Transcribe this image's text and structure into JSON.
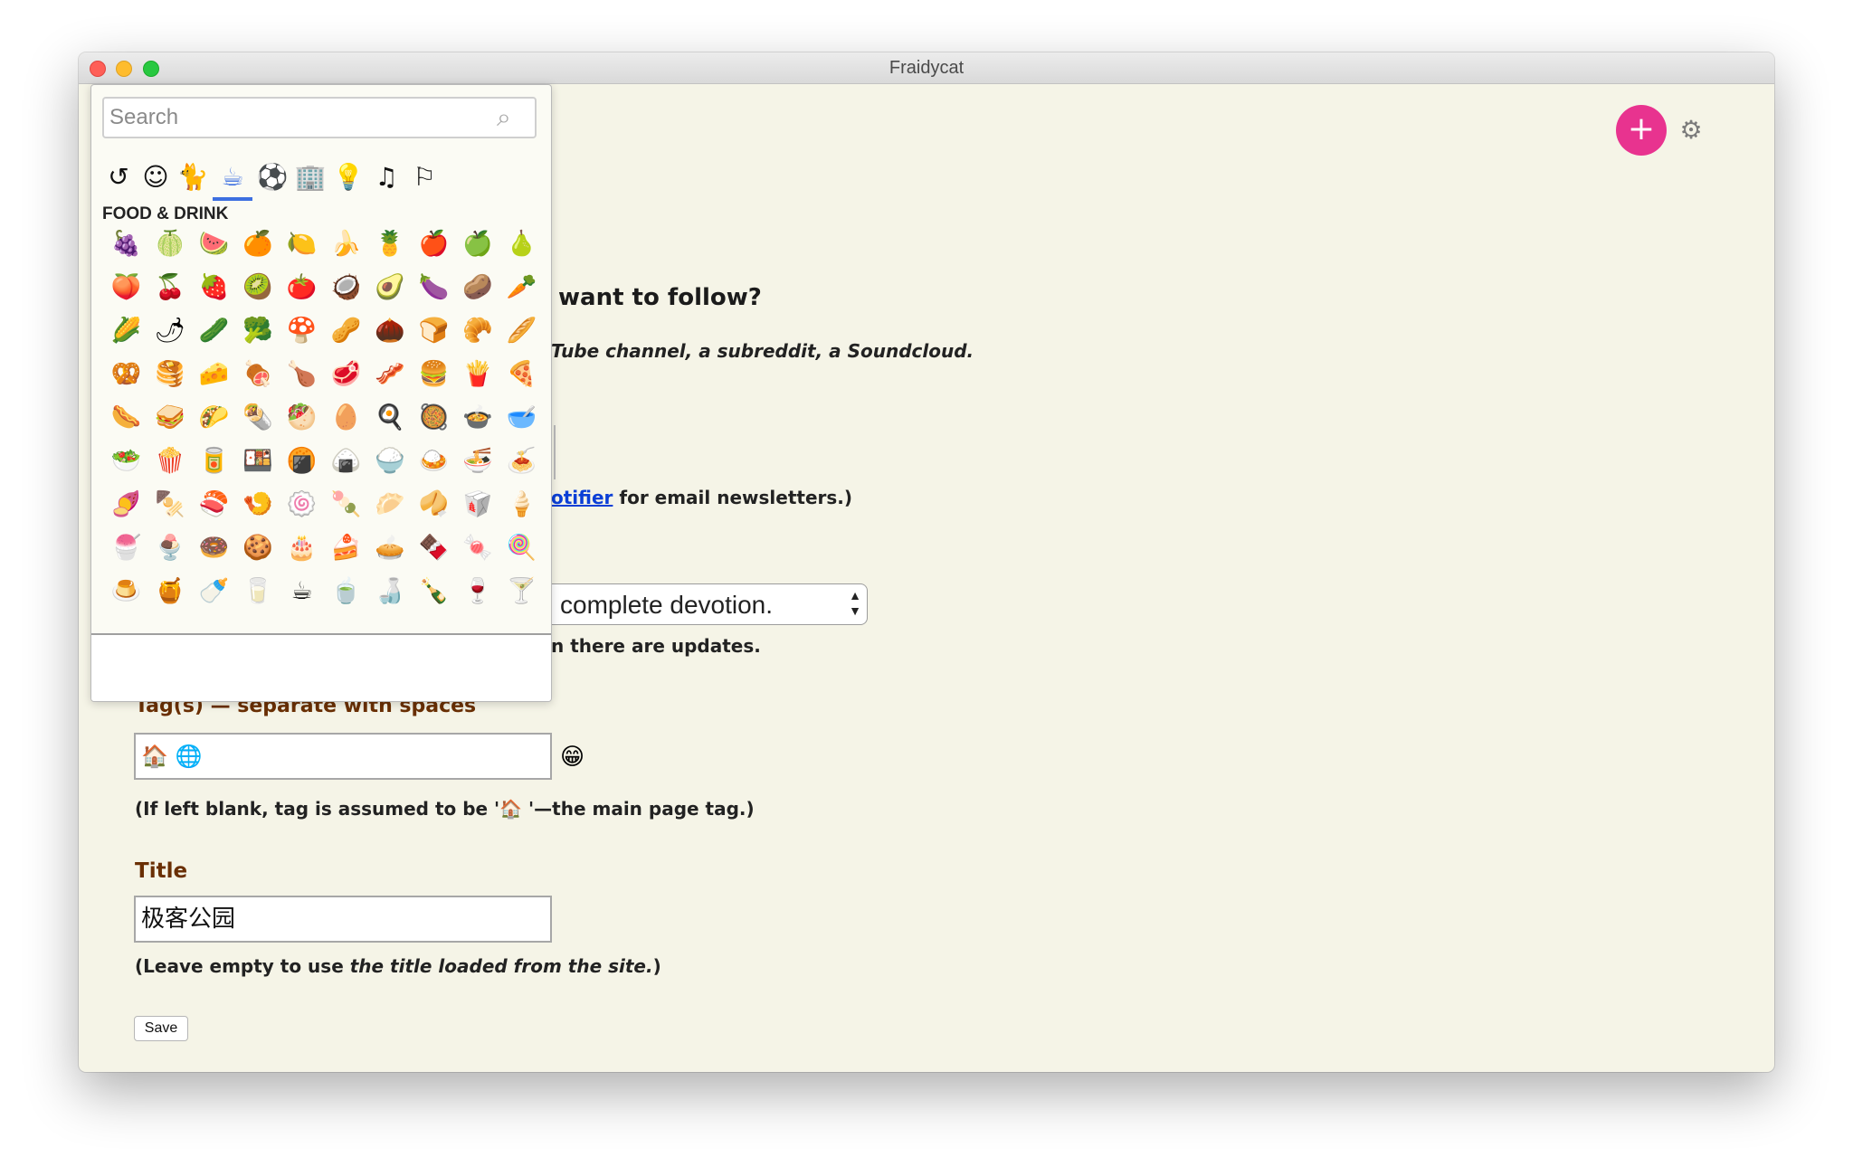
{
  "window": {
    "title": "Fraidycat"
  },
  "page": {
    "heading_partial": "want to follow?",
    "subheading_partial": "Tube channel, a subreddit, a Soundcloud.",
    "notifier_link_partial": "otifier",
    "notifier_suffix": " for email newsletters.)",
    "frequency_select_partial": "complete devotion.",
    "updates_help_partial": "n there are updates.",
    "tags_label": "Tag(s) — separate with spaces",
    "tags_value": "🏠 🌐",
    "tags_emoji_button": "😁",
    "tags_help": "(If left blank, tag is assumed to be '🏠 '—the main page tag.)",
    "title_label": "Title",
    "title_value": "极客公园",
    "title_help_prefix": "(Leave empty to use ",
    "title_help_italic": "the title loaded from the site.",
    "title_help_suffix": ")",
    "save_label": "Save"
  },
  "header": {
    "add_label": "+",
    "settings_icon": "gear-icon"
  },
  "emoji_picker": {
    "search_placeholder": "Search",
    "categories": [
      {
        "name": "recent",
        "glyph": "↺"
      },
      {
        "name": "smileys",
        "glyph": "☺"
      },
      {
        "name": "animals",
        "glyph": "🐈"
      },
      {
        "name": "food",
        "glyph": "☕",
        "active": true
      },
      {
        "name": "activity",
        "glyph": "⚽"
      },
      {
        "name": "travel",
        "glyph": "🏢"
      },
      {
        "name": "objects",
        "glyph": "💡"
      },
      {
        "name": "symbols",
        "glyph": "♫"
      },
      {
        "name": "flags",
        "glyph": "⚐"
      }
    ],
    "category_title": "FOOD & DRINK",
    "rows": [
      [
        "🍇",
        "🍈",
        "🍉",
        "🍊",
        "🍋",
        "🍌",
        "🍍",
        "🍎",
        "🍏",
        "🍐"
      ],
      [
        "🍑",
        "🍒",
        "🍓",
        "🥝",
        "🍅",
        "🥥",
        "🥑",
        "🍆",
        "🥔",
        "🥕"
      ],
      [
        "🌽",
        "🌶",
        "🥒",
        "🥦",
        "🍄",
        "🥜",
        "🌰",
        "🍞",
        "🥐",
        "🥖"
      ],
      [
        "🥨",
        "🥞",
        "🧀",
        "🍖",
        "🍗",
        "🥩",
        "🥓",
        "🍔",
        "🍟",
        "🍕"
      ],
      [
        "🌭",
        "🥪",
        "🌮",
        "🌯",
        "🥙",
        "🥚",
        "🍳",
        "🥘",
        "🍲",
        "🥣"
      ],
      [
        "🥗",
        "🍿",
        "🥫",
        "🍱",
        "🍘",
        "🍙",
        "🍚",
        "🍛",
        "🍜",
        "🍝"
      ],
      [
        "🍠",
        "🍢",
        "🍣",
        "🍤",
        "🍥",
        "🍡",
        "🥟",
        "🥠",
        "🥡",
        "🍦"
      ],
      [
        "🍧",
        "🍨",
        "🍩",
        "🍪",
        "🎂",
        "🍰",
        "🥧",
        "🍫",
        "🍬",
        "🍭"
      ],
      [
        "🍮",
        "🍯",
        "🍼",
        "🥛",
        "☕",
        "🍵",
        "🍶",
        "🍾",
        "🍷",
        "🍸"
      ]
    ]
  }
}
